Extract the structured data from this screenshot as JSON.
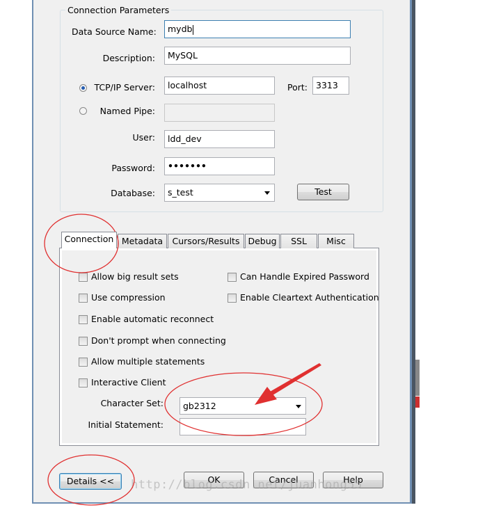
{
  "connection_parameters": {
    "group_title": "Connection Parameters",
    "data_source_name": {
      "label": "Data Source Name:",
      "value": "mydb"
    },
    "description": {
      "label": "Description:",
      "value": "MySQL"
    },
    "tcpip_server": {
      "label": "TCP/IP Server:",
      "value": "localhost",
      "selected": true
    },
    "port": {
      "label": "Port:",
      "value": "3313"
    },
    "named_pipe": {
      "label": "Named Pipe:",
      "value": "",
      "selected": false
    },
    "user": {
      "label": "User:",
      "value": "ldd_dev"
    },
    "password": {
      "label": "Password:",
      "value": "•••••••"
    },
    "database": {
      "label": "Database:",
      "value": "s_test"
    },
    "test_button": "Test"
  },
  "tabs": [
    {
      "label": "Connection",
      "active": true
    },
    {
      "label": "Metadata",
      "active": false
    },
    {
      "label": "Cursors/Results",
      "active": false
    },
    {
      "label": "Debug",
      "active": false
    },
    {
      "label": "SSL",
      "active": false
    },
    {
      "label": "Misc",
      "active": false
    }
  ],
  "connection_tab": {
    "options_left": [
      {
        "label": "Allow big result sets",
        "checked": false
      },
      {
        "label": "Use compression",
        "checked": false
      },
      {
        "label": "Enable automatic reconnect",
        "checked": false
      },
      {
        "label": "Don't prompt when connecting",
        "checked": false
      },
      {
        "label": "Allow multiple statements",
        "checked": false
      },
      {
        "label": "Interactive Client",
        "checked": false
      }
    ],
    "options_right": [
      {
        "label": "Can Handle Expired Password",
        "checked": false
      },
      {
        "label": "Enable Cleartext Authentication",
        "checked": false
      }
    ],
    "character_set": {
      "label": "Character Set:",
      "value": "gb2312"
    },
    "initial_statement": {
      "label": "Initial Statement:",
      "value": ""
    }
  },
  "footer": {
    "details_button": "Details <<",
    "ok_button": "OK",
    "cancel_button": "Cancel",
    "help_button": "Help"
  },
  "watermark": "http://blog.csdn.net/juanhong55",
  "colors": {
    "annotation_red": "#e03030",
    "accent_blue": "#3c7fb1"
  }
}
